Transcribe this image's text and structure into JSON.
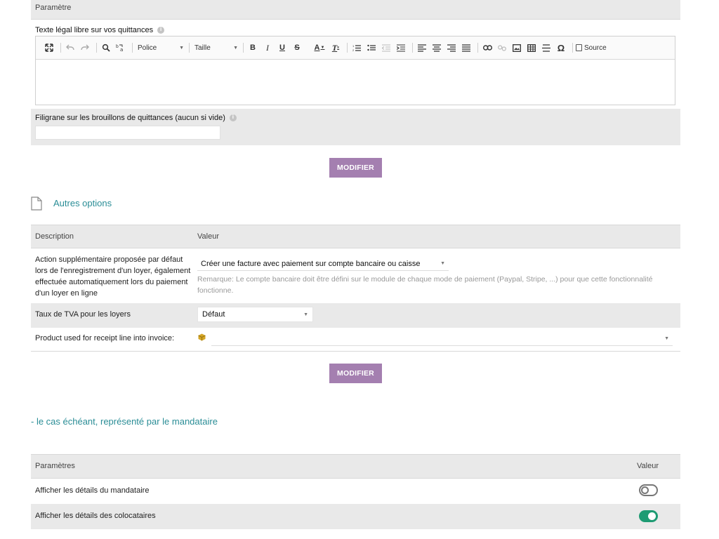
{
  "section_params": {
    "header": "Paramètre",
    "legal_text_label": "Texte légal libre sur vos quittances",
    "legal_text_value": "",
    "watermark_label": "Filigrane sur les brouillons de quittances (aucun si vide)",
    "watermark_value": "",
    "modify_button": "MODIFIER"
  },
  "editor_toolbar": {
    "font_label": "Police",
    "size_label": "Taille",
    "source_label": "Source",
    "special_char": "Ω",
    "bold": "B",
    "italic": "I",
    "underline": "U",
    "strike": "S",
    "text_color": "A",
    "remove_format": "T"
  },
  "other_options": {
    "title": "Autres options",
    "col_description": "Description",
    "col_value": "Valeur",
    "rows": [
      {
        "label": "Action supplémentaire proposée par défaut lors de l'enregistrement d'un loyer, également effectuée automatiquement lors du paiement d'un loyer en ligne",
        "value": "Créer une facture avec paiement sur compte bancaire ou caisse",
        "note": "Remarque: Le compte bancaire doit être défini sur le module de chaque mode de paiement (Paypal, Stripe, ...) pour que cette fonctionnalité fonctionne."
      },
      {
        "label": "Taux de TVA pour les loyers",
        "value": "Défaut"
      },
      {
        "label": "Product used for receipt line into invoice:",
        "value": ""
      }
    ],
    "modify_button": "MODIFIER"
  },
  "mandataire_title": "- le cas échéant, représenté par le mandataire",
  "display_params": {
    "col_params": "Paramètres",
    "col_value": "Valeur",
    "rows": [
      {
        "label": "Afficher les détails du mandataire",
        "enabled": false
      },
      {
        "label": "Afficher les détails des colocataires",
        "enabled": true
      }
    ]
  },
  "colors": {
    "accent_teal": "#2a8d96",
    "button_purple": "#a47fb0",
    "toggle_on": "#1e9b73",
    "header_grey": "#e9e9e9"
  }
}
